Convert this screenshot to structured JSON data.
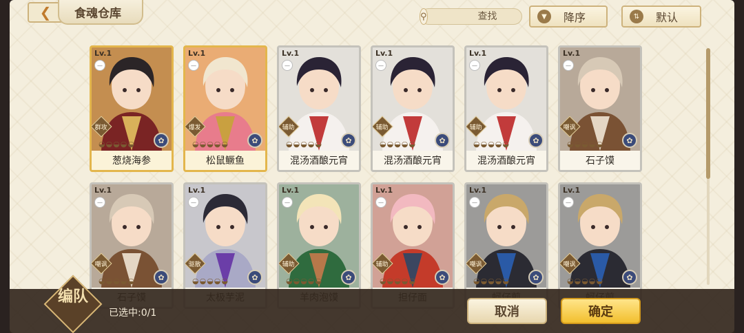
{
  "header": {
    "title": "食魂仓库",
    "search_placeholder": "查找",
    "sort_label": "降序",
    "filter_label": "默认"
  },
  "cards": [
    {
      "level": "Lv.1",
      "name": "葱烧海参",
      "role": "群攻",
      "rarity": "gold",
      "palette": [
        "#2b2527",
        "#7a2424",
        "#d9b15a"
      ]
    },
    {
      "level": "Lv.1",
      "name": "松鼠鳜鱼",
      "role": "爆发",
      "rarity": "gold",
      "palette": [
        "#f1e6cf",
        "#e87c8c",
        "#c9a040"
      ]
    },
    {
      "level": "Lv.1",
      "name": "混汤酒酿元宵",
      "role": "辅助",
      "rarity": "silver",
      "palette": [
        "#2a2335",
        "#f5f1ee",
        "#c23b3b"
      ]
    },
    {
      "level": "Lv.1",
      "name": "混汤酒酿元宵",
      "role": "辅助",
      "rarity": "silver",
      "palette": [
        "#2a2335",
        "#f5f1ee",
        "#c23b3b"
      ]
    },
    {
      "level": "Lv.1",
      "name": "混汤酒酿元宵",
      "role": "辅助",
      "rarity": "silver",
      "palette": [
        "#2a2335",
        "#f5f1ee",
        "#c23b3b"
      ]
    },
    {
      "level": "Lv.1",
      "name": "石子馍",
      "role": "嘲讽",
      "rarity": "silver",
      "palette": [
        "#d7c9b6",
        "#7a5234",
        "#e4d6c4"
      ]
    },
    {
      "level": "Lv.1",
      "name": "石子馍",
      "role": "嘲讽",
      "rarity": "silver",
      "palette": [
        "#d7c9b6",
        "#7a5234",
        "#e4d6c4"
      ]
    },
    {
      "level": "Lv.1",
      "name": "太极芋泥",
      "role": "驱散",
      "rarity": "silver",
      "palette": [
        "#2c2a36",
        "#a9a9c6",
        "#6b3ea8"
      ]
    },
    {
      "level": "Lv.1",
      "name": "羊肉泡馍",
      "role": "辅助",
      "rarity": "silver",
      "palette": [
        "#f3e4b8",
        "#2f6b3e",
        "#b7784a"
      ]
    },
    {
      "level": "Lv.1",
      "name": "担仔面",
      "role": "辅助",
      "rarity": "silver",
      "palette": [
        "#f2b9c0",
        "#c43b2a",
        "#3b4660"
      ]
    },
    {
      "level": "Lv.1",
      "name": "蚵仔煎",
      "role": "嘲讽",
      "rarity": "silver",
      "palette": [
        "#c9a86a",
        "#2b2b33",
        "#2a5aa6"
      ]
    },
    {
      "level": "Lv.1",
      "name": "蚵仔煎",
      "role": "嘲讽",
      "rarity": "silver",
      "palette": [
        "#c9a86a",
        "#2b2b33",
        "#2a5aa6"
      ]
    }
  ],
  "footer": {
    "team_label": "编队",
    "selected_text": "已选中:0/1",
    "cancel_label": "取消",
    "confirm_label": "确定"
  },
  "icons": {
    "back": "back-arrow-icon",
    "search": "search-icon",
    "clear": "clear-icon",
    "sort": "sort-desc-icon",
    "filter": "filter-icon",
    "emblem": "flower-emblem-icon"
  }
}
